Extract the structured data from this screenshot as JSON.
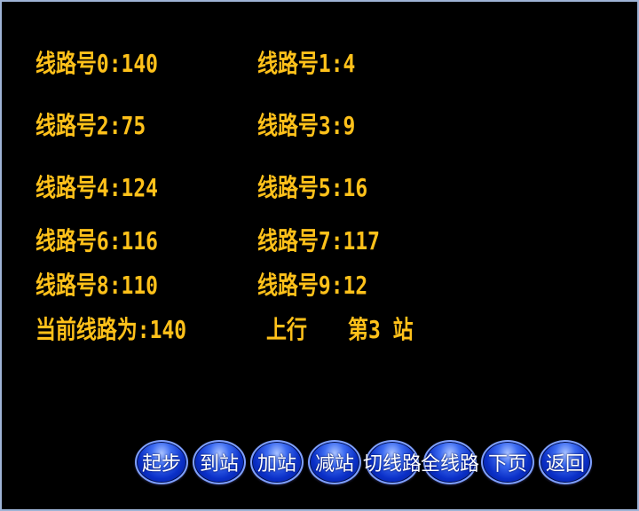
{
  "lines": [
    {
      "label": "线路号0:140"
    },
    {
      "label": "线路号1:4"
    },
    {
      "label": "线路号2:75"
    },
    {
      "label": "线路号3:9"
    },
    {
      "label": "线路号4:124"
    },
    {
      "label": "线路号5:16"
    },
    {
      "label": "线路号6:116"
    },
    {
      "label": "线路号7:117"
    },
    {
      "label": "线路号8:110"
    },
    {
      "label": "线路号9:12"
    }
  ],
  "status": {
    "current_line": "当前线路为:140",
    "direction": "上行",
    "station": "第3 站"
  },
  "buttons": [
    {
      "label": "起步"
    },
    {
      "label": "到站"
    },
    {
      "label": "加站"
    },
    {
      "label": "减站"
    },
    {
      "label": "切线路"
    },
    {
      "label": "全线路"
    },
    {
      "label": "下页"
    },
    {
      "label": "返回"
    }
  ],
  "colors": {
    "background": "#000000",
    "text": "#ffc11a",
    "button": "#0a2fc7",
    "border": "#9fb4d6"
  }
}
